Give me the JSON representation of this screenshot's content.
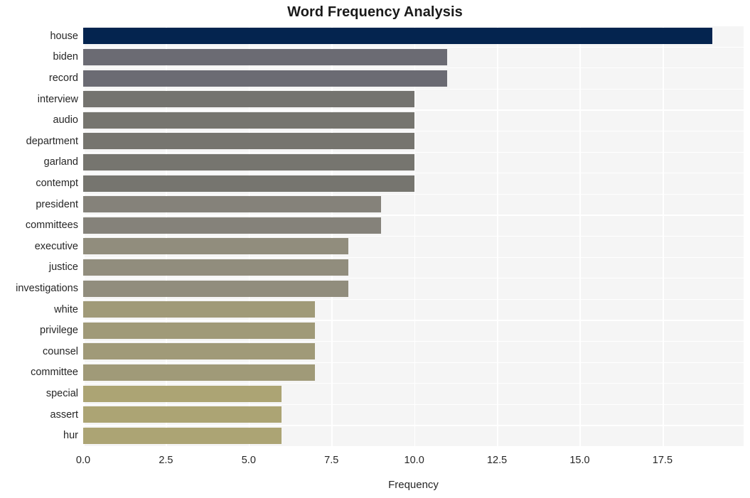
{
  "chart_data": {
    "type": "bar",
    "orientation": "horizontal",
    "title": "Word Frequency Analysis",
    "xlabel": "Frequency",
    "ylabel": "",
    "xlim": [
      0,
      19.95
    ],
    "xticks": [
      "0.0",
      "2.5",
      "5.0",
      "7.5",
      "10.0",
      "12.5",
      "15.0",
      "17.5"
    ],
    "xtick_values": [
      0.0,
      2.5,
      5.0,
      7.5,
      10.0,
      12.5,
      15.0,
      17.5
    ],
    "grid": true,
    "legend": "none",
    "categories": [
      "house",
      "biden",
      "record",
      "interview",
      "audio",
      "department",
      "garland",
      "contempt",
      "president",
      "committees",
      "executive",
      "justice",
      "investigations",
      "white",
      "privilege",
      "counsel",
      "committee",
      "special",
      "assert",
      "hur"
    ],
    "values": [
      19,
      11,
      11,
      10,
      10,
      10,
      10,
      10,
      9,
      9,
      8,
      8,
      8,
      7,
      7,
      7,
      7,
      6,
      6,
      6
    ],
    "bar_colors": [
      "#04244f",
      "#6b6b73",
      "#6b6b73",
      "#74736f",
      "#76756f",
      "#76756f",
      "#76756f",
      "#76756f",
      "#85827a",
      "#85827a",
      "#918d7d",
      "#918d7d",
      "#918d7d",
      "#a09a78",
      "#a09a78",
      "#a09a78",
      "#a09a78",
      "#aca474",
      "#aca474",
      "#aca474"
    ],
    "plot_background": "#f5f5f5",
    "gridline_color": "#ffffff",
    "figure_background": "#ffffff",
    "text_color": "#262626"
  }
}
